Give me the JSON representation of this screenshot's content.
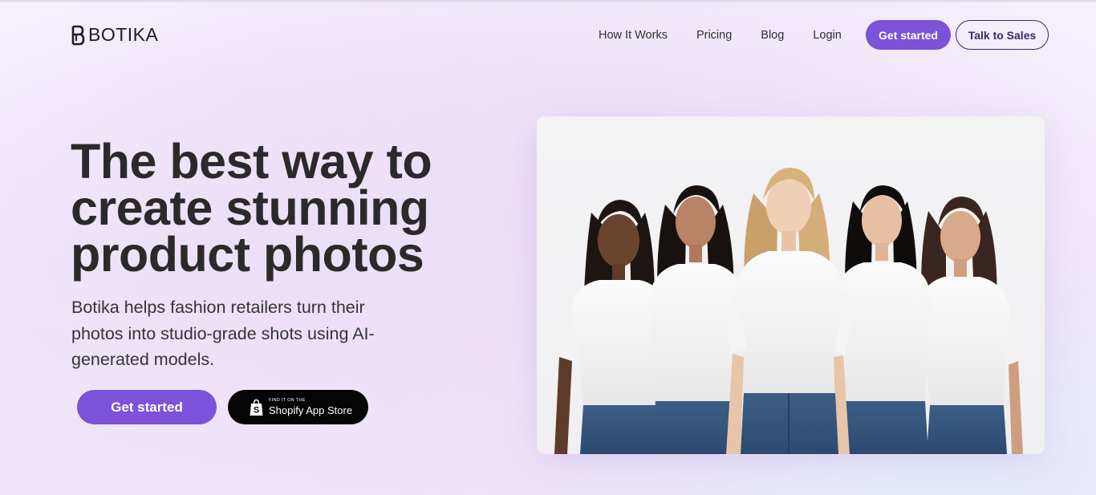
{
  "brand": {
    "name": "BOTIKA"
  },
  "nav": {
    "links": [
      "How It Works",
      "Pricing",
      "Blog",
      "Login"
    ],
    "cta_primary": "Get started",
    "cta_secondary": "Talk to Sales"
  },
  "hero": {
    "headline": "The best way to create stunning product photos",
    "subtext": "Botika helps fashion retailers turn their photos into studio-grade shots using AI-generated models.",
    "cta_primary": "Get started",
    "shopify": {
      "small": "FIND IT ON THE",
      "big": "Shopify App Store"
    }
  },
  "colors": {
    "accent": "#7b52d9",
    "outline": "#3a2a6e",
    "text": "#2a2a2a",
    "shopify_bg": "#050505"
  },
  "icons": [
    "botika-logo-icon",
    "shopify-bag-icon"
  ],
  "image": {
    "subject": "five-models-in-white-tshirts-and-jeans"
  }
}
